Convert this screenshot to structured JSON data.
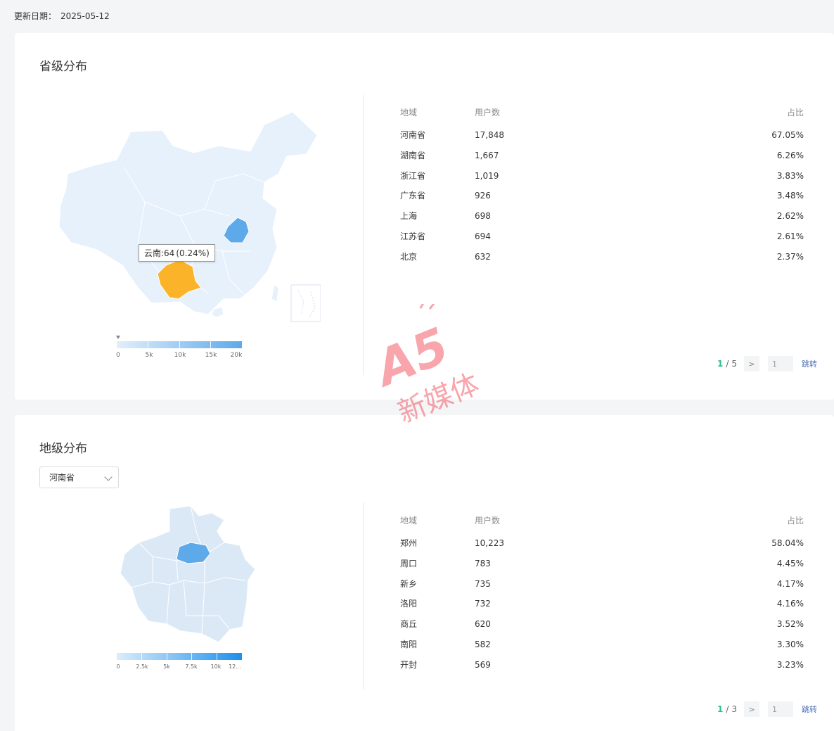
{
  "update": {
    "label": "更新日期：",
    "date": "2025-05-12"
  },
  "province": {
    "title": "省级分布",
    "tooltip": {
      "region": "云南:64",
      "pct": "(0.24%)"
    },
    "legend_ticks": [
      "0",
      "5k",
      "10k",
      "15k",
      "20k"
    ],
    "headers": {
      "region": "地域",
      "users": "用户数",
      "pct": "占比"
    },
    "rows": [
      {
        "region": "河南省",
        "users": "17,848",
        "pct": "67.05%"
      },
      {
        "region": "湖南省",
        "users": "1,667",
        "pct": "6.26%"
      },
      {
        "region": "浙江省",
        "users": "1,019",
        "pct": "3.83%"
      },
      {
        "region": "广东省",
        "users": "926",
        "pct": "3.48%"
      },
      {
        "region": "上海",
        "users": "698",
        "pct": "2.62%"
      },
      {
        "region": "江苏省",
        "users": "694",
        "pct": "2.61%"
      },
      {
        "region": "北京",
        "users": "632",
        "pct": "2.37%"
      }
    ],
    "pager": {
      "current": "1",
      "sep": "/",
      "total": "5",
      "input": "1",
      "jump": "跳转"
    }
  },
  "city": {
    "title": "地级分布",
    "select_value": "河南省",
    "legend_ticks": [
      "0",
      "2.5k",
      "5k",
      "7.5k",
      "10k",
      "12..."
    ],
    "headers": {
      "region": "地域",
      "users": "用户数",
      "pct": "占比"
    },
    "rows": [
      {
        "region": "郑州",
        "users": "10,223",
        "pct": "58.04%"
      },
      {
        "region": "周口",
        "users": "783",
        "pct": "4.45%"
      },
      {
        "region": "新乡",
        "users": "735",
        "pct": "4.17%"
      },
      {
        "region": "洛阳",
        "users": "732",
        "pct": "4.16%"
      },
      {
        "region": "商丘",
        "users": "620",
        "pct": "3.52%"
      },
      {
        "region": "南阳",
        "users": "582",
        "pct": "3.30%"
      },
      {
        "region": "开封",
        "users": "569",
        "pct": "3.23%"
      }
    ],
    "pager": {
      "current": "1",
      "sep": "/",
      "total": "3",
      "input": "1",
      "jump": "跳转"
    }
  },
  "watermark": {
    "logo": "A5",
    "text": "新媒体"
  },
  "icons": {
    "next": "chevron-right-icon",
    "dropdown": "chevron-down-icon",
    "marker": "legend-marker-icon"
  },
  "colors": {
    "accent_green": "#2dbe8a",
    "map_base": "#e6f1fc",
    "map_highlight": "#5ea9ea",
    "map_hover": "#fbb42a",
    "link": "#4b6fb6"
  }
}
